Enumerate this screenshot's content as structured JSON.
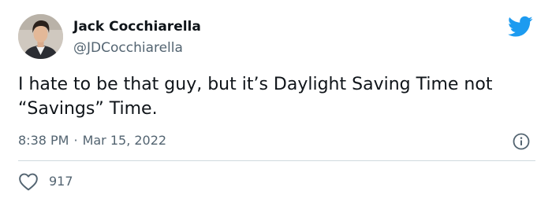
{
  "author": {
    "name": "Jack Cocchiarella",
    "handle": "@JDCocchiarella"
  },
  "tweet": {
    "text": "I hate to be that guy, but it’s Daylight Saving Time not “Savings” Time.",
    "time": "8:38 PM",
    "separator": "·",
    "date": "Mar 15, 2022"
  },
  "actions": {
    "like_count": "917"
  },
  "icons": {
    "brand": "twitter-bird-icon",
    "info": "info-icon",
    "like": "heart-icon"
  },
  "colors": {
    "brand_blue": "#1d9bf0",
    "text_primary": "#0f1419",
    "text_secondary": "#536471",
    "divider": "#cfd9de"
  }
}
